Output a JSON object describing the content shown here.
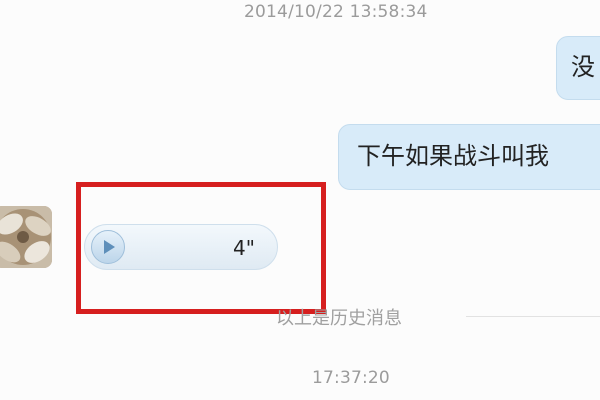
{
  "chat": {
    "timestamp_top": "2014/10/22 13:58:34",
    "messages_right": [
      {
        "text": "没"
      },
      {
        "text": "下午如果战斗叫我"
      }
    ],
    "voice_message": {
      "duration": "4\""
    },
    "history_divider": "以上是历史消息",
    "timestamp_bottom": "17:37:20"
  },
  "colors": {
    "bubble_right": "#d8ebf9",
    "highlight": "#d61f1f",
    "voice_play": "#5e8fba"
  },
  "icons": {
    "play": "play-icon"
  }
}
